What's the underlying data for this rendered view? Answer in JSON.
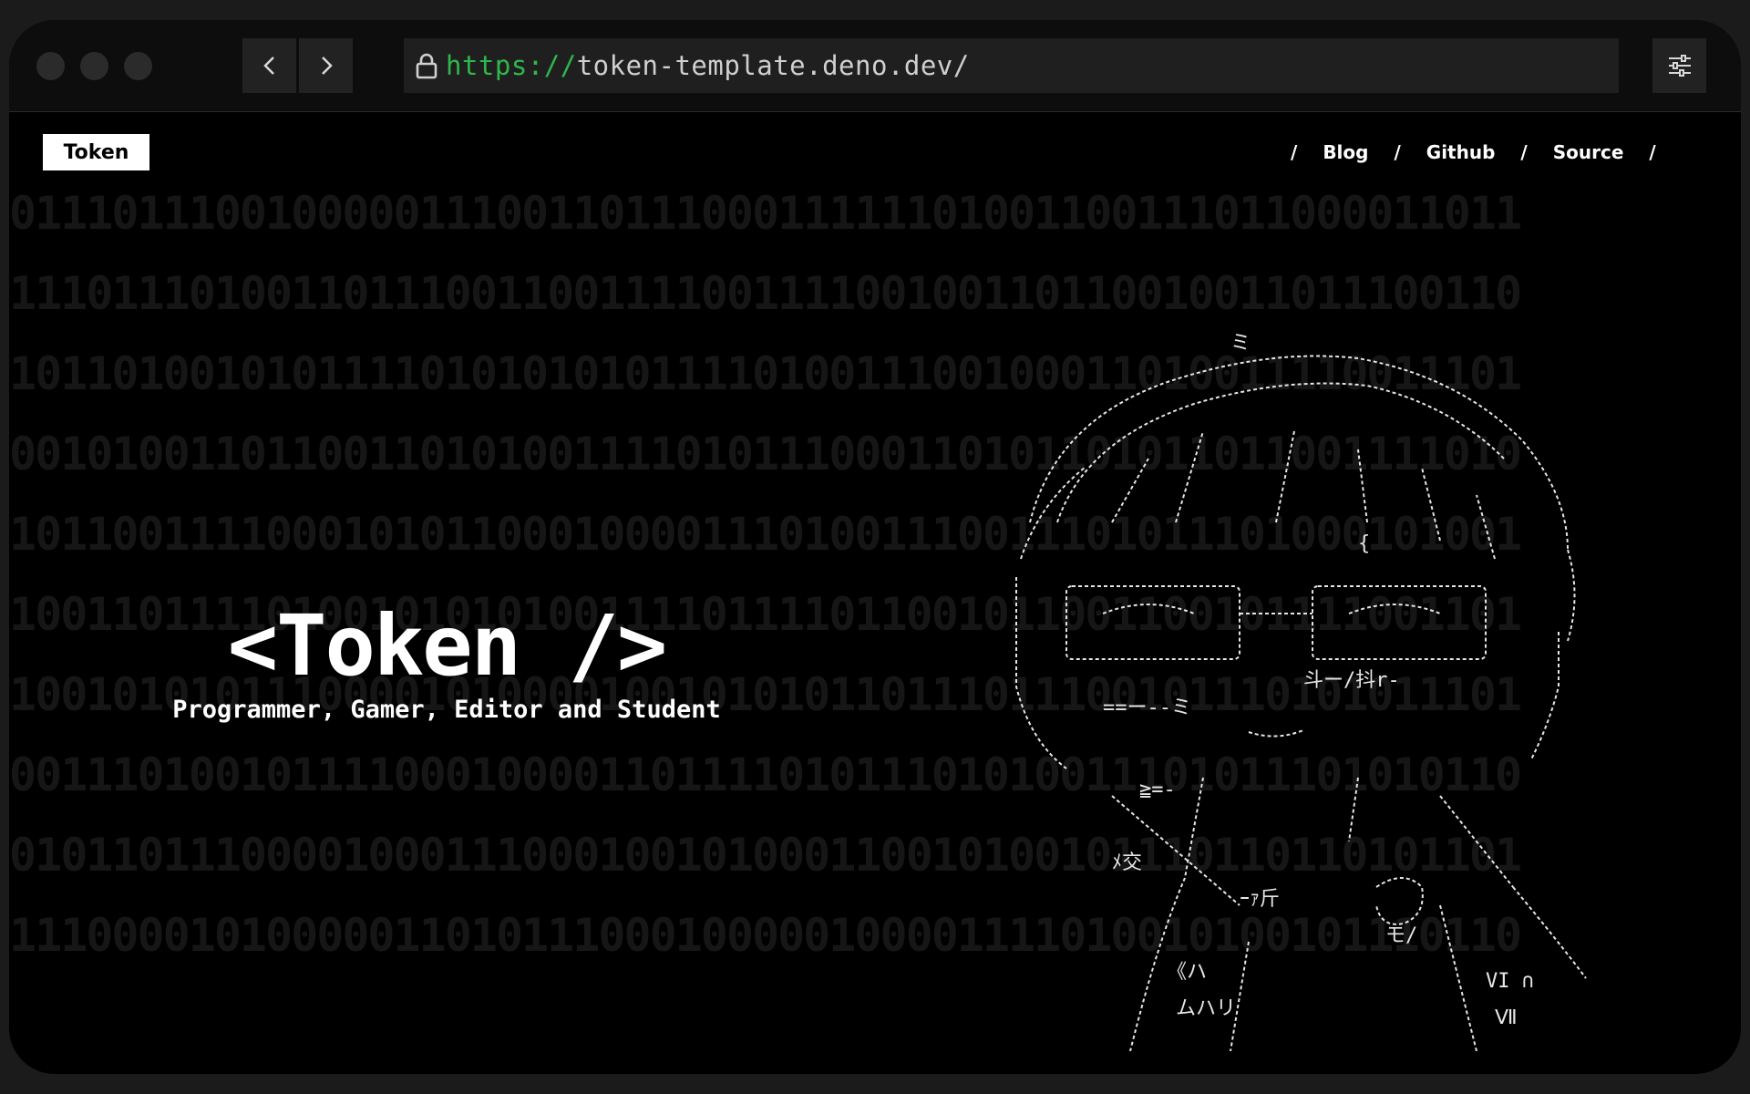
{
  "browser": {
    "url_scheme": "https://",
    "url_host": "token-template.deno.dev/",
    "back_icon": "chevron-left-icon",
    "forward_icon": "chevron-right-icon",
    "lock_icon": "lock-icon",
    "settings_icon": "sliders-icon"
  },
  "header": {
    "logo": "Token",
    "nav": [
      {
        "label": "Blog"
      },
      {
        "label": "Github"
      },
      {
        "label": "Source"
      }
    ],
    "separator": "/"
  },
  "hero": {
    "title": "<Token />",
    "subtitle": "Programmer, Gamer, Editor and Student"
  },
  "background_binary": [
    "01110111001000001110011011100011111101001100111011000011011",
    "11101110100110111001100111100111100100110110010011011100110",
    "10110100101011110101010101111010011100100011010011110011101",
    "00101001101100110101001111010111000110101101011011001111010",
    "10110011110001010110001000011101001110011101011101000101001",
    "10011011110100101010100111101111011001011001100101111001101",
    "10010101011100001010000100101010110111011100101110101011101",
    "00111010010111100010000110111101011101010011101011101010110",
    "01011011100001000111000100101000110010100101110110110101101",
    "11100001010000011010111000100000100001111010010100101110110"
  ],
  "colors": {
    "accent_green": "#2fb74b",
    "page_bg": "#000000",
    "text": "#ffffff"
  }
}
